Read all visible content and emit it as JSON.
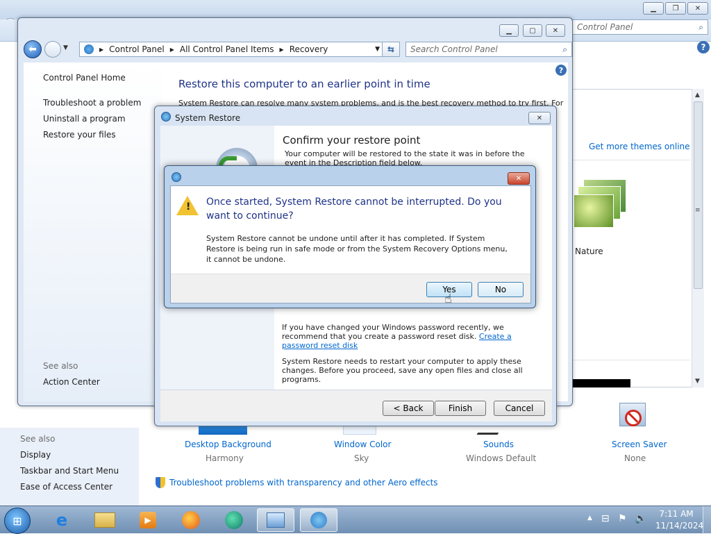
{
  "background_window": {
    "search_placeholder": "Control Panel",
    "get_more_themes": "Get more themes online",
    "theme_name": "Nature",
    "see_also": "See also",
    "links": [
      "Display",
      "Taskbar and Start Menu",
      "Ease of Access Center"
    ],
    "items": [
      {
        "label": "Desktop Background",
        "value": "Harmony"
      },
      {
        "label": "Window Color",
        "value": "Sky"
      },
      {
        "label": "Sounds",
        "value": "Windows Default"
      },
      {
        "label": "Screen Saver",
        "value": "None"
      }
    ],
    "troubleshoot_link": "Troubleshoot problems with transparency and other Aero effects"
  },
  "recovery_window": {
    "breadcrumb": [
      "Control Panel",
      "All Control Panel Items",
      "Recovery"
    ],
    "search_placeholder": "Search Control Panel",
    "sidebar": {
      "home": "Control Panel Home",
      "items": [
        "Troubleshoot a problem",
        "Uninstall a program",
        "Restore your files"
      ],
      "see_also": "See also",
      "action_center": "Action Center"
    },
    "heading": "Restore this computer to an earlier point in time",
    "intro": "System Restore can resolve many system problems, and is the best recovery method to try first. For"
  },
  "system_restore": {
    "title": "System Restore",
    "heading": "Confirm your restore point",
    "intro": "Your computer will be restored to the state it was in before the event in the Description field below.",
    "password_text": "If you have changed your Windows password recently, we recommend that you create a password reset disk.",
    "password_link": "Create a password reset disk",
    "restart_text": "System Restore needs to restart your computer to apply these changes. Before you proceed, save any open files and close all programs.",
    "buttons": {
      "back": "< Back",
      "finish": "Finish",
      "cancel": "Cancel"
    }
  },
  "dialog": {
    "title": "Once started, System Restore cannot be interrupted. Do you want to continue?",
    "message": "System Restore cannot be undone until after it has completed. If System Restore is being run in safe mode or from the System Recovery Options menu, it cannot be undone.",
    "buttons": {
      "yes": "Yes",
      "no": "No"
    }
  },
  "taskbar": {
    "time": "7:11 AM",
    "date": "11/14/2024"
  }
}
